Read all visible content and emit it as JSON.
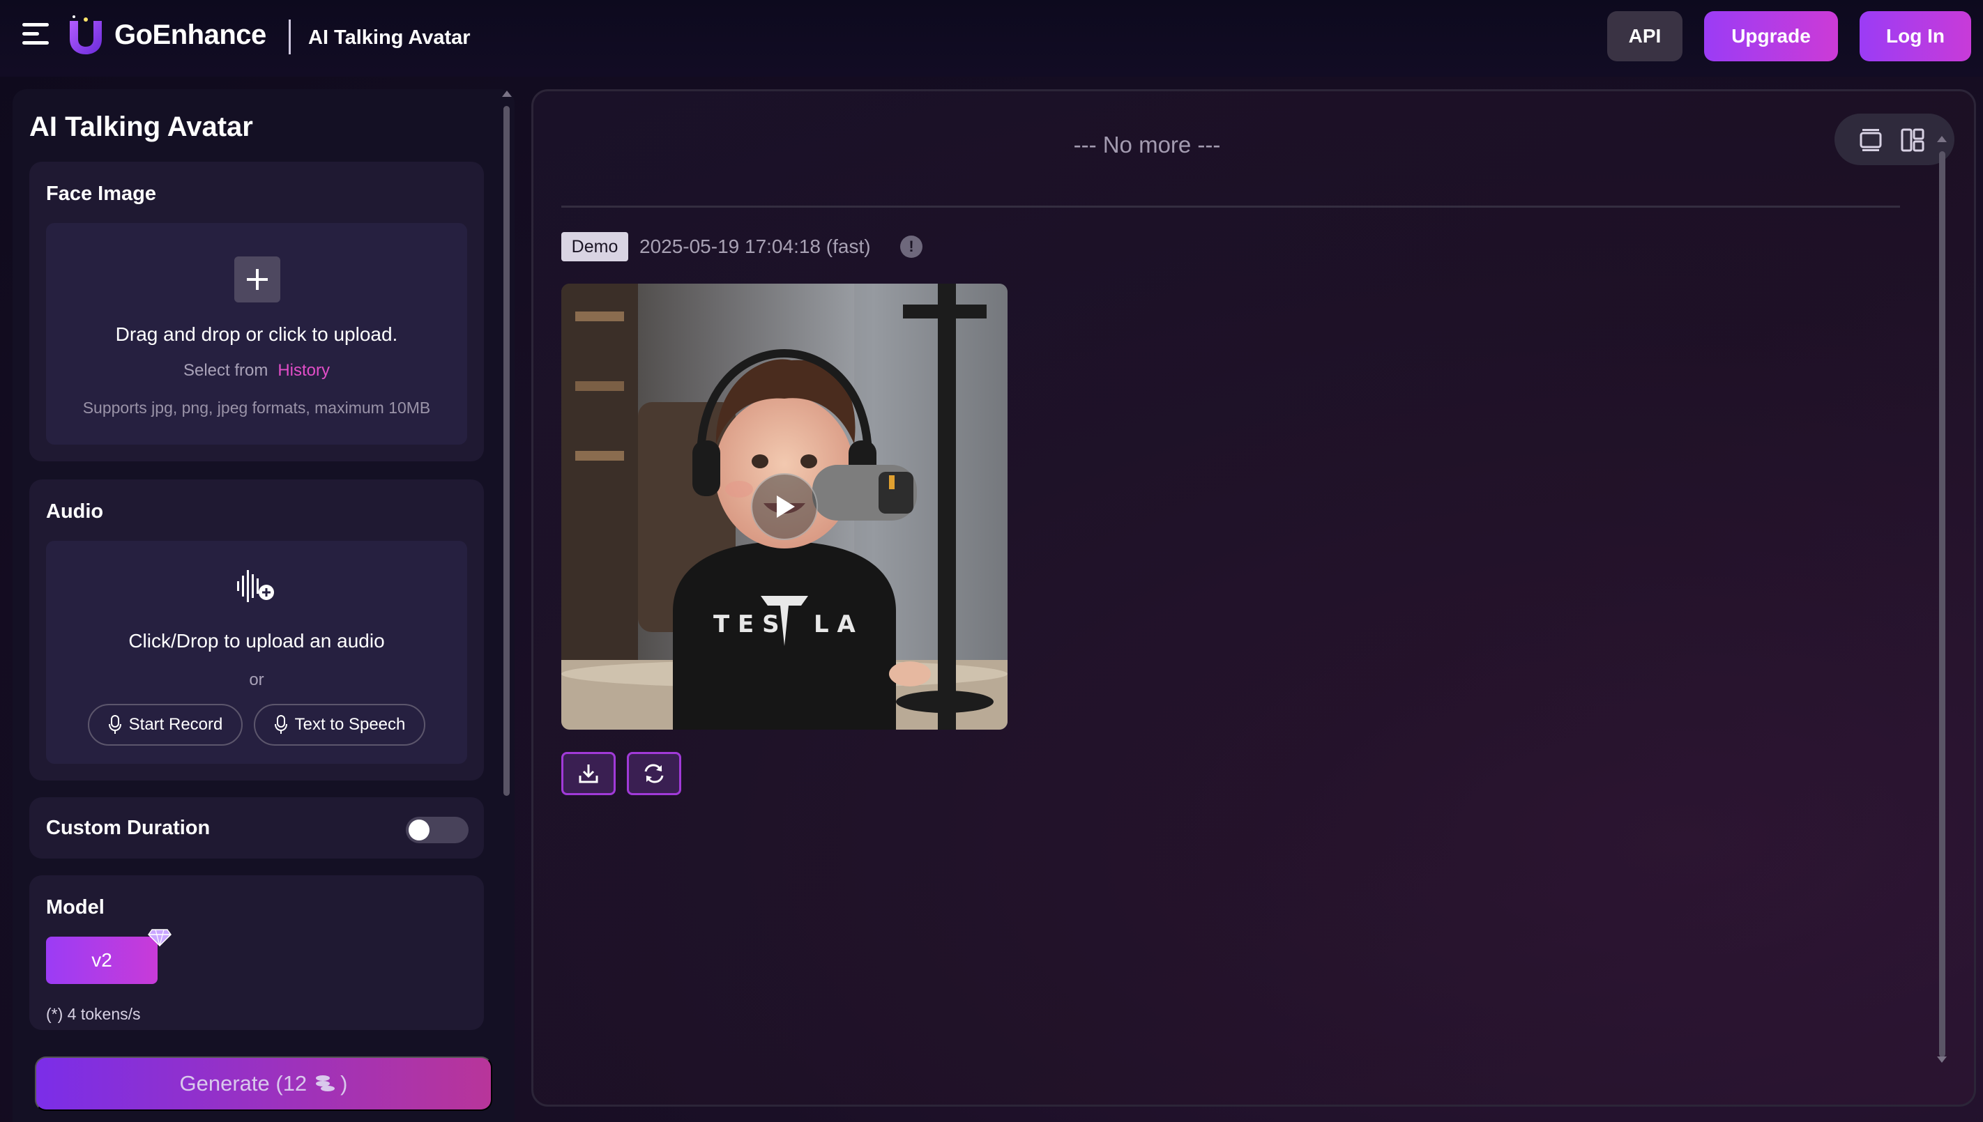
{
  "header": {
    "brand": "GoEnhance",
    "page_title": "AI Talking Avatar",
    "api_label": "API",
    "upgrade_label": "Upgrade",
    "login_label": "Log In"
  },
  "left_panel": {
    "title": "AI Talking Avatar",
    "face_image": {
      "title": "Face Image",
      "upload_text": "Drag and drop or click to upload.",
      "select_from": "Select from",
      "history_link": "History",
      "formats_hint": "Supports jpg, png, jpeg formats, maximum 10MB"
    },
    "audio": {
      "title": "Audio",
      "upload_text": "Click/Drop to upload an audio",
      "or_text": "or",
      "start_record": "Start Record",
      "text_to_speech": "Text to Speech"
    },
    "custom_duration": {
      "title": "Custom Duration",
      "enabled": false
    },
    "model": {
      "title": "Model",
      "selected": "v2",
      "tokens_note": "(*) 4 tokens/s"
    },
    "generate": {
      "label": "Generate (12",
      "suffix": ")"
    }
  },
  "right_panel": {
    "no_more_text": "--- No more ---",
    "item": {
      "badge": "Demo",
      "timestamp": "2025-05-19 17:04:18 (fast)",
      "info_symbol": "!"
    }
  },
  "colors": {
    "accent_gradient_start": "#9b3cf5",
    "accent_gradient_end": "#c83bd8",
    "history_link": "#e24ec8"
  }
}
